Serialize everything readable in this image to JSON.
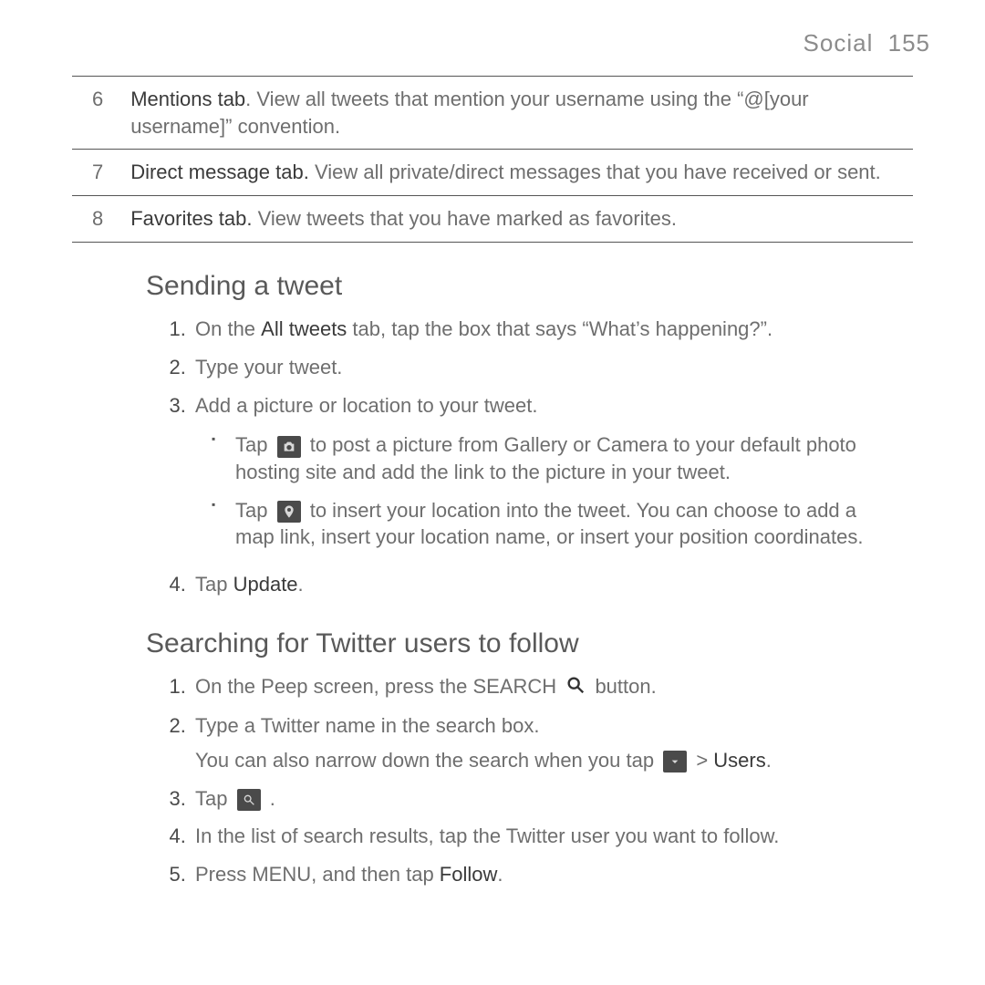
{
  "header": {
    "section": "Social",
    "page": "155"
  },
  "table": {
    "rows": [
      {
        "num": "6",
        "label": "Mentions tab",
        "sep": ". ",
        "body": "View all tweets that mention your username using the “@[your username]” convention."
      },
      {
        "num": "7",
        "label": "Direct message tab.",
        "sep": " ",
        "body": "View all private/direct messages that you have received or sent."
      },
      {
        "num": "8",
        "label": "Favorites tab.",
        "sep": " ",
        "body": "View tweets that you have marked as favorites."
      }
    ]
  },
  "sec1": {
    "title": "Sending a tweet",
    "s1a": "On the ",
    "s1b": "All tweets",
    "s1c": " tab, tap the box that says “What’s happening?”.",
    "s2": "Type your tweet.",
    "s3": "Add a picture or location to your tweet.",
    "b1a": "Tap ",
    "b1b": " to post a picture from Gallery or Camera to your default photo hosting site and add the link to the picture in your tweet.",
    "b2a": "Tap ",
    "b2b": " to insert your location into the tweet. You can choose to add a map link, insert your location name, or insert your position coordinates.",
    "s4a": "Tap ",
    "s4b": "Update",
    "s4c": "."
  },
  "sec2": {
    "title": "Searching for Twitter users to follow",
    "s1a": "On the Peep screen, press the SEARCH ",
    "s1b": " button.",
    "s2": "Type a Twitter name in the search box.",
    "s2pa": "You can also narrow down the search when you tap ",
    "s2pb": " > ",
    "s2pc": "Users",
    "s2pd": ".",
    "s3a": "Tap ",
    "s3b": ".",
    "s4": "In the list of search results, tap the Twitter user you want to follow.",
    "s5a": "Press MENU, and then tap ",
    "s5b": "Follow",
    "s5c": "."
  }
}
